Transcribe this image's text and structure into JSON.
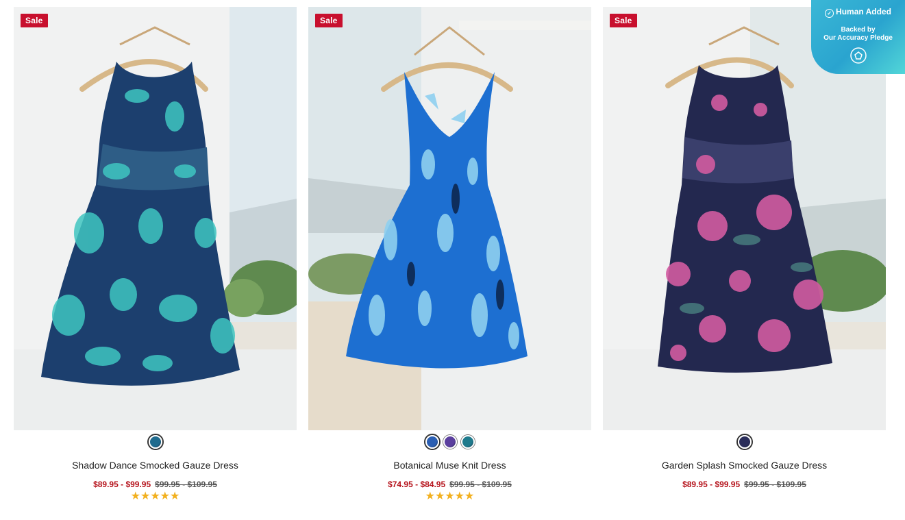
{
  "products": [
    {
      "badge": "Sale",
      "name": "Shadow Dance Smocked Gauze Dress",
      "sale_price": "$89.95 - $99.95",
      "orig_price": "$99.95 - $109.95",
      "rating_text": "★★★★★",
      "rating": 5,
      "swatch_colors": [
        "#1f6b8e"
      ],
      "dress_colors": {
        "base": "#1c3f6e",
        "print": "#3fc6c1"
      }
    },
    {
      "badge": "Sale",
      "name": "Botanical Muse Knit Dress",
      "sale_price": "$74.95 - $84.95",
      "orig_price": "$99.95 - $109.95",
      "rating_text": "★★★★★",
      "rating": 5,
      "swatch_colors": [
        "#2b5fb3",
        "#5b3f9e",
        "#1f7a8c"
      ],
      "dress_colors": {
        "base": "#1d6fd1",
        "print": "#8fd0f0"
      }
    },
    {
      "badge": "Sale",
      "name": "Garden Splash Smocked Gauze Dress",
      "sale_price": "$89.95 - $99.95",
      "orig_price": "$99.95 - $109.95",
      "rating_text": "★★★★★",
      "rating": 0,
      "swatch_colors": [
        "#2a2d5a"
      ],
      "dress_colors": {
        "base": "#23284f",
        "print": "#d15ba0"
      }
    }
  ],
  "accuracy_badge": {
    "title": "Human Added",
    "line1": "Backed by",
    "line2": "Our Accuracy Pledge"
  }
}
